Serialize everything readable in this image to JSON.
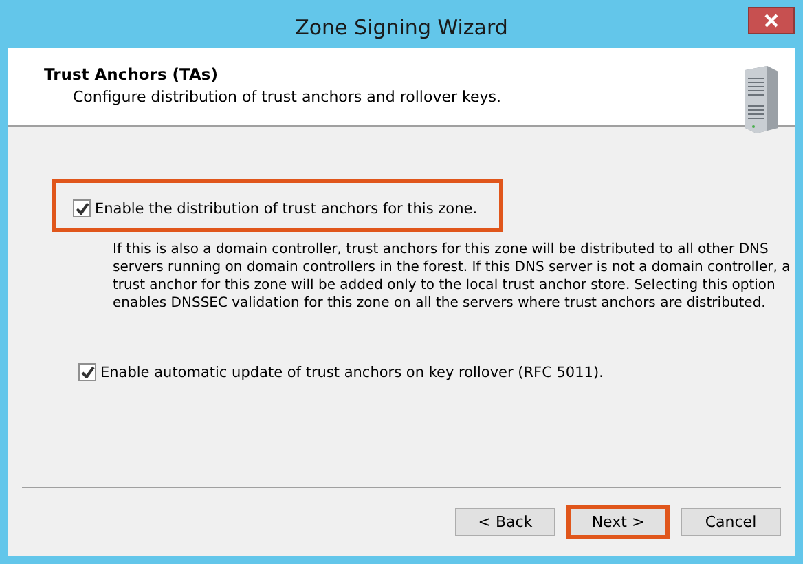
{
  "window": {
    "title": "Zone Signing Wizard"
  },
  "header": {
    "title": "Trust Anchors (TAs)",
    "subtitle": "Configure distribution of trust anchors and rollover keys."
  },
  "options": [
    {
      "label": "Enable the distribution of trust anchors for this zone.",
      "checked": true,
      "highlighted": true,
      "description": "If this is also a domain controller, trust anchors for this zone will be distributed to all other DNS servers running on domain controllers in the forest. If this DNS server is not a domain controller, a trust anchor for this zone will be added only to the local trust anchor store. Selecting this option enables DNSSEC validation for this zone on all the servers where trust anchors are distributed."
    },
    {
      "label": "Enable automatic update of trust anchors on key rollover (RFC 5011).",
      "checked": true,
      "highlighted": false
    }
  ],
  "buttons": [
    {
      "label": "< Back",
      "highlighted": false
    },
    {
      "label": "Next >",
      "highlighted": true
    },
    {
      "label": "Cancel",
      "highlighted": false
    }
  ]
}
